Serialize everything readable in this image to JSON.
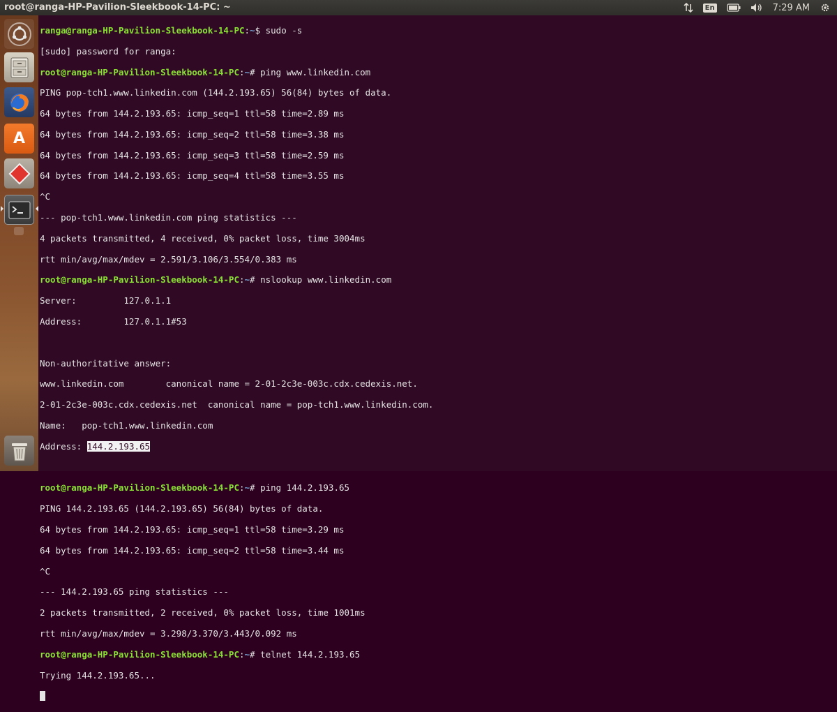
{
  "topbar": {
    "window_title": "root@ranga-HP-Pavilion-Sleekbook-14-PC: ~",
    "lang": "En",
    "clock": "7:29 AM"
  },
  "launcher": {
    "items": [
      {
        "name": "ubuntu-dash",
        "icon": "ubuntu-logo-icon"
      },
      {
        "name": "files",
        "icon": "file-cabinet-icon"
      },
      {
        "name": "firefox",
        "icon": "firefox-icon"
      },
      {
        "name": "software-center",
        "icon": "shopping-bag-icon",
        "glyph": "A"
      },
      {
        "name": "anbox",
        "icon": "diamond-icon"
      },
      {
        "name": "terminal",
        "icon": "terminal-icon",
        "glyph": ">_"
      },
      {
        "name": "trash",
        "icon": "trash-icon"
      }
    ]
  },
  "terminal": {
    "prompt_user": "root@ranga-HP-Pavilion-Sleekbook-14-PC",
    "l1": {
      "user": "ranga@ranga-HP-Pavilion-Sleekbook-14-PC",
      "path": "~",
      "sym": "$",
      "cmd": " sudo -s"
    },
    "l2": "[sudo] password for ranga:",
    "l3": {
      "path": "~",
      "sym": "#",
      "cmd": " ping www.linkedin.com"
    },
    "l4": "PING pop-tch1.www.linkedin.com (144.2.193.65) 56(84) bytes of data.",
    "l5": "64 bytes from 144.2.193.65: icmp_seq=1 ttl=58 time=2.89 ms",
    "l6": "64 bytes from 144.2.193.65: icmp_seq=2 ttl=58 time=3.38 ms",
    "l7": "64 bytes from 144.2.193.65: icmp_seq=3 ttl=58 time=2.59 ms",
    "l8": "64 bytes from 144.2.193.65: icmp_seq=4 ttl=58 time=3.55 ms",
    "l9": "^C",
    "l10": "--- pop-tch1.www.linkedin.com ping statistics ---",
    "l11": "4 packets transmitted, 4 received, 0% packet loss, time 3004ms",
    "l12": "rtt min/avg/max/mdev = 2.591/3.106/3.554/0.383 ms",
    "l13": {
      "path": "~",
      "sym": "#",
      "cmd": " nslookup www.linkedin.com"
    },
    "l14": "Server:         127.0.1.1",
    "l15": "Address:        127.0.1.1#53",
    "l16": "",
    "l17": "Non-authoritative answer:",
    "l18": "www.linkedin.com        canonical name = 2-01-2c3e-003c.cdx.cedexis.net.",
    "l19": "2-01-2c3e-003c.cdx.cedexis.net  canonical name = pop-tch1.www.linkedin.com.",
    "l20": "Name:   pop-tch1.www.linkedin.com",
    "l21": {
      "label": "Address: ",
      "value": "144.2.193.65"
    },
    "l22": "",
    "l23": {
      "path": "~",
      "sym": "#",
      "cmd": " ping 144.2.193.65"
    },
    "l24": "PING 144.2.193.65 (144.2.193.65) 56(84) bytes of data.",
    "l25": "64 bytes from 144.2.193.65: icmp_seq=1 ttl=58 time=3.29 ms",
    "l26": "64 bytes from 144.2.193.65: icmp_seq=2 ttl=58 time=3.44 ms",
    "l27": "^C",
    "l28": "--- 144.2.193.65 ping statistics ---",
    "l29": "2 packets transmitted, 2 received, 0% packet loss, time 1001ms",
    "l30": "rtt min/avg/max/mdev = 3.298/3.370/3.443/0.092 ms",
    "l31": {
      "path": "~",
      "sym": "#",
      "cmd": " telnet 144.2.193.65"
    },
    "l32": "Trying 144.2.193.65..."
  },
  "colors": {
    "terminal_bg": "#300a24",
    "prompt_green": "#8ae234",
    "path_blue": "#729fcf",
    "text": "#e4e4e4"
  }
}
